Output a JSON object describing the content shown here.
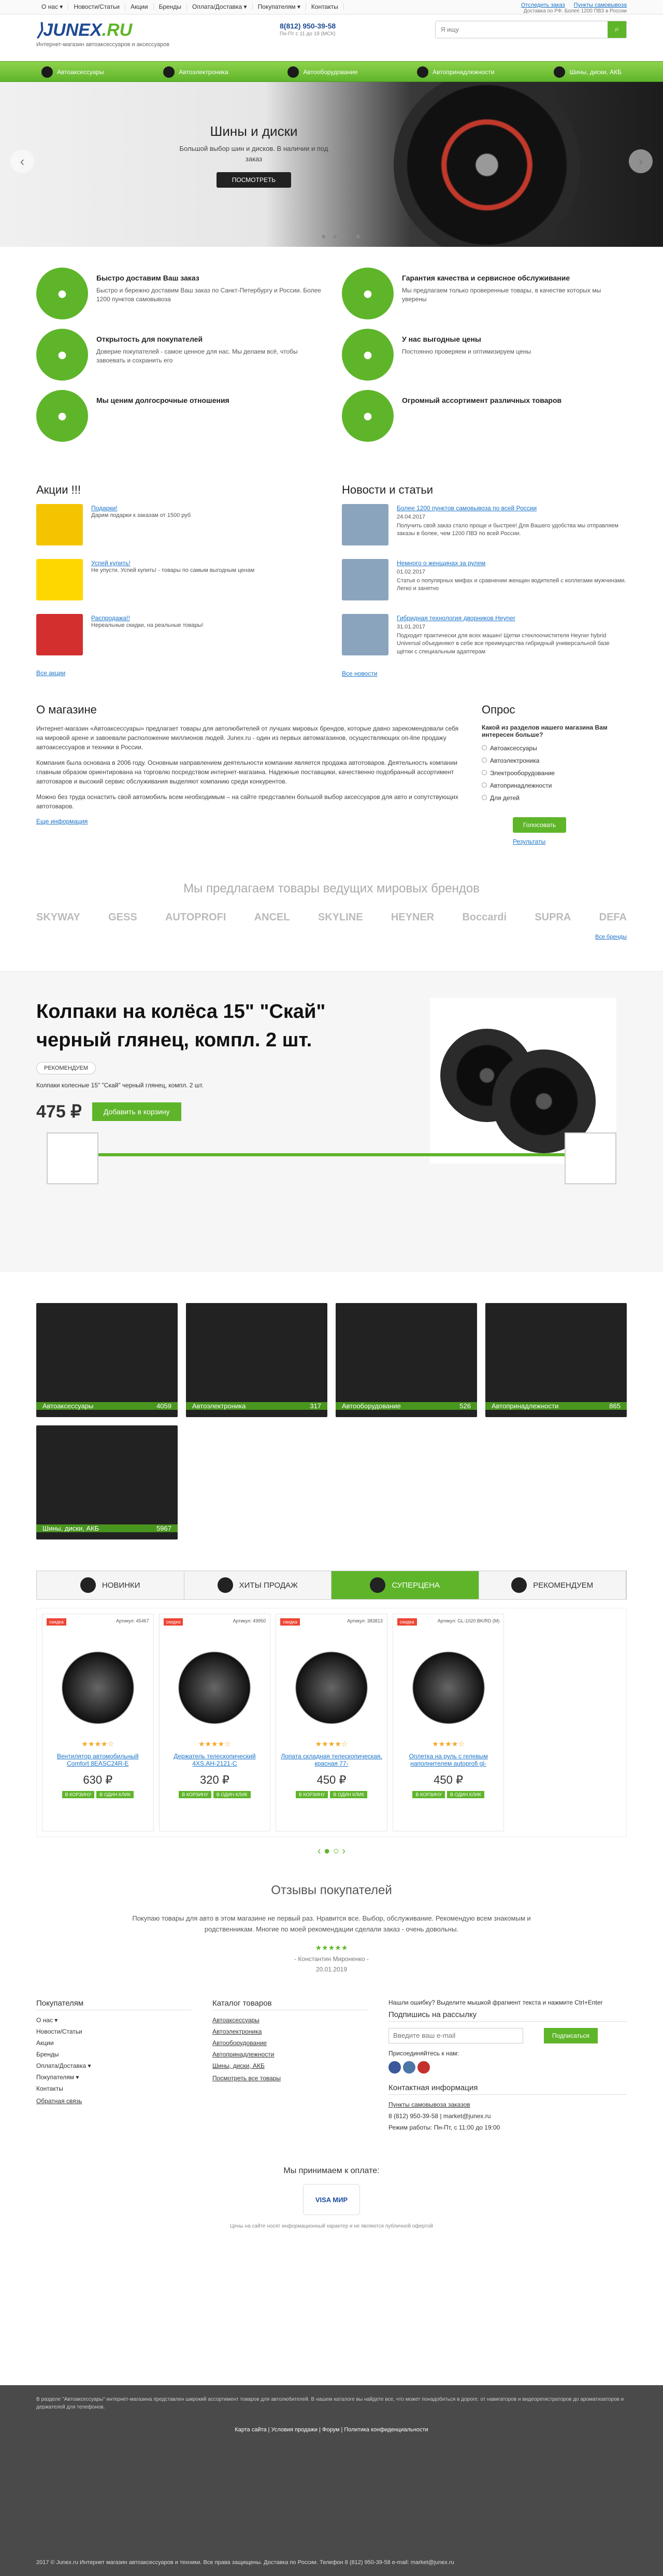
{
  "topnav": {
    "menu": [
      "О нас ▾",
      "Новости/Статьи",
      "Акции",
      "Бренды",
      "Оплата/Доставка ▾",
      "Покупателям ▾",
      "Контакты"
    ],
    "links": [
      "Отследить заказ",
      "Пункты самовывоза"
    ],
    "delivery": "Доставка по РФ. Более 1200 ПВЗ в России"
  },
  "header": {
    "logo_main": "JUNEX",
    "logo_suffix": ".RU",
    "tagline": "Интернет-магазин автоаксессуаров и аксессуаров",
    "phone": "8(812) 950-39-58",
    "hours": "Пн-Пт с 11 до 19 (МСК)",
    "search_placeholder": "Я ищу"
  },
  "categories": [
    "Автоаксессуары",
    "Автоэлектроника",
    "Автооборудование",
    "Автопринадлежности",
    "Шины, диски, АКБ"
  ],
  "slider": {
    "title": "Шины и диски",
    "text": "Большой выбор шин и дисков. В наличии и под заказ",
    "button": "ПОСМОТРЕТЬ"
  },
  "features": [
    {
      "title": "Быстро доставим Ваш заказ",
      "text": "Быстро и бережно доставим Ваш заказ по Санкт-Петербургу и России. Более 1200 пунктов самовывоза",
      "icon": "truck-icon"
    },
    {
      "title": "Гарантия качества и сервисное обслуживание",
      "text": "Мы предлагаем только проверенные товары, в качестве которых мы уверены",
      "icon": "check-icon"
    },
    {
      "title": "Открытость для покупателей",
      "text": "Доверие покупателей - самое ценное для нас. Мы делаем всё, чтобы завоевать и сохранить его",
      "icon": "handshake-icon"
    },
    {
      "title": "У нас выгодные цены",
      "text": "Постоянно проверяем и оптимизируем цены",
      "icon": "percent-icon"
    },
    {
      "title": "Мы ценим долгосрочные отношения",
      "text": "",
      "icon": "heart-icon"
    },
    {
      "title": "Огромный ассортимент различных товаров",
      "text": "",
      "icon": "box-icon"
    }
  ],
  "promos": {
    "title": "Акции !!!",
    "items": [
      {
        "link": "Подарки!",
        "text": "Дарим подарки к заказам от 1500 руб"
      },
      {
        "link": "Успей купить!",
        "text": "Не упусти. Успей купить! - товары по самым выгодным ценам"
      },
      {
        "link": "Распродажа!!",
        "text": "Нереальные скидки, на реальные товары!"
      }
    ],
    "all": "Все акции"
  },
  "news": {
    "title": "Новости и статьи",
    "items": [
      {
        "link": "Более 1200 пунктов самовывоза по всей России",
        "date": "24.04.2017",
        "text": "Получить свой заказ стало проще и быстрее! Для Вашего удобства мы отправляем заказы в более, чем 1200 ПВЗ по всей России."
      },
      {
        "link": "Немного о женщинах за рулем",
        "date": "01.02.2017",
        "text": "Статья о популярных мифах и сравнении женщин водителей с коллегами мужчинами. Легко и занятно"
      },
      {
        "link": "Гибридная технология дворников Heyner",
        "date": "31.01.2017",
        "text": "Подходит практически для всех машин! Щетки стеклоочистителя Heyner hybrid Universal объединяют в себе все преимущества гибридный универсальной базе щётки с специальным адаптерам"
      }
    ],
    "all": "Все новости"
  },
  "about": {
    "title": "О магазине",
    "paras": [
      "Интернет-магазин «Автоаксессуары» предлагает товары для автолюбителей от лучших мировых брендов, которые давно зарекомендовали себя на мировой арене и завоевали расположение миллионов людей. Junex.ru - один из первых автомагазинов, осуществляющих on-line продажу автоаксессуаров и техники в России.",
      "Компания была основана в 2006 году. Основным направлением деятельности компании является продажа автотоваров. Деятельность компании главным образом ориентирована на торговлю посредством интернет-магазина. Надежные поставщики, качественно подобранный ассортимент автотоваров и высокий сервис обслуживания выделяют компанию среди конкурентов.",
      "Можно без труда оснастить свой автомобиль всем необходимым – на сайте представлен большой выбор аксессуаров для авто и сопутствующих автотоваров."
    ],
    "more": "Еще информация"
  },
  "poll": {
    "title": "Опрос",
    "question": "Какой из разделов нашего магазина Вам интересен больше?",
    "options": [
      "Автоаксессуары",
      "Автоэлектроника",
      "Электрооборудование",
      "Автопринадлежности",
      "Для детей"
    ],
    "vote": "Голосовать",
    "results": "Результаты"
  },
  "brands": {
    "title": "Мы предлагаем товары ведущих мировых брендов",
    "names": [
      "SKYWAY",
      "GESS",
      "AUTOPROFI",
      "ANCEL",
      "SKYLINE",
      "HEYNER",
      "Boccardi",
      "SUPRA",
      "DEFA"
    ],
    "all": "Все бренды"
  },
  "featured": {
    "title": "Колпаки на колёса 15\" \"Скай\" черный глянец, компл. 2 шт.",
    "badge": "РЕКОМЕНДУЕМ",
    "desc": "Колпаки колесные 15\" \"Скай\" черный глянец, компл. 2 шт.",
    "price": "475 ₽",
    "cart": "Добавить в корзину"
  },
  "catgrid": [
    {
      "name": "Автоаксессуары",
      "count": "4059"
    },
    {
      "name": "Автоэлектроника",
      "count": "317"
    },
    {
      "name": "Автооборудование",
      "count": "526"
    },
    {
      "name": "Автопринадлежности",
      "count": "865"
    },
    {
      "name": "Шины, диски, АКБ",
      "count": "5967"
    }
  ],
  "tabs": [
    "НОВИНКИ",
    "ХИТЫ ПРОДАЖ",
    "СУПЕРЦЕНА",
    "РЕКОМЕНДУЕМ"
  ],
  "products": [
    {
      "tag": "скидка",
      "art": "Артикул: 45467",
      "name": "Вентилятор автомобильный Comfort 8EASC24R-E",
      "price": "630 ₽"
    },
    {
      "tag": "скидка",
      "art": "Артикул: 49950",
      "name": "Держатель телескопический 4XS.AH-2121-C",
      "price": "320 ₽"
    },
    {
      "tag": "скидка",
      "art": "Артикул: 383813",
      "name": "Лопата складная телескопическая, красная 77-",
      "price": "450 ₽"
    },
    {
      "tag": "скидка",
      "art": "Артикул: GL-1020 BK/RD (M)",
      "name": "Оплетка на руль с гелевым наполнителем autoprofi gl-",
      "price": "450 ₽"
    }
  ],
  "inst": [
    "В КОРЗИНУ",
    "В ОДИН КЛИК"
  ],
  "reviews": {
    "title": "Отзывы покупателей",
    "text": "Покупаю товары для авто в этом магазине не первый раз. Нравится все. Выбор, обслуживание. Рекомендую всем знакомым и родственникам. Многие по моей рекомендации сделали заказ - очень довольны.",
    "author": "- Константин Мироненко -",
    "date": "20.01.2019"
  },
  "footer": {
    "buyers_title": "Покупателям",
    "buyers": [
      "О нас ▾",
      "Новости/Статьи",
      "Акции",
      "Бренды",
      "Оплата/Доставка ▾",
      "Покупателям ▾",
      "Контакты"
    ],
    "feedback": "Обратная связь",
    "catalog_title": "Каталог товаров",
    "catalog": [
      "Автоаксессуары",
      "Автоэлектроника",
      "Автооборудование",
      "Автопринадлежности",
      "Шины, диски, АКБ"
    ],
    "catalog_all": "Посмотреть все товары",
    "error": "Нашли ошибку? Выделите мышкой фрагмент текста и нажмите Ctrl+Enter",
    "sub_title": "Подпишись на рассылку",
    "sub_placeholder": "Введите ваш e-mail",
    "sub_button": "Подписаться",
    "social": "Присоединяйтесь к нам:",
    "contact_title": "Контактная информация",
    "pickup": "Пункты самовывоза заказов",
    "phone": "8 (812) 950-39-58",
    "mail": "market@junex.ru",
    "hours": "Режим работы: Пн-Пт, с 11:00 до 19:00"
  },
  "pay": {
    "title": "Мы принимаем к оплате:",
    "logo": "VISA МИР",
    "note": "Цены на сайте носят информационный характер и не являются публичной офертой"
  },
  "bottom": {
    "disclaimer": "В разделе \"Автоаксессуары\" интернет-магазина представлен широкий ассортимент товаров для автолюбителей. В нашем каталоге вы найдете все, что может понадобиться в дороге: от навигаторов и видеорегистраторов до ароматизаторов и держателей для телефонов.",
    "links": "Карта сайта | Условия продажи | Форум | Политика конфиденциальности",
    "copy": "2017 © Junex.ru Интернет магазин автоаксессуаров и техники. Все права защищены. Доставка по России. Телефон 8 (812) 950-39-58 e-mail: market@junex.ru"
  }
}
